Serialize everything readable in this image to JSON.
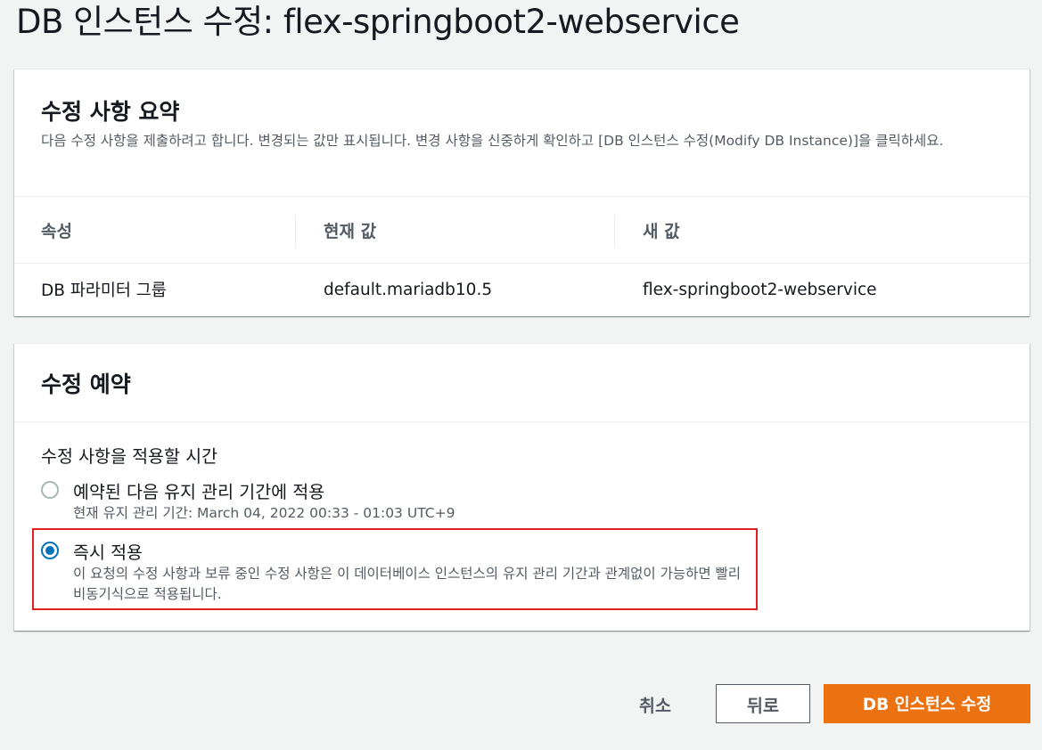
{
  "page": {
    "title": "DB 인스턴스 수정: flex-springboot2-webservice"
  },
  "summary": {
    "heading": "수정 사항 요약",
    "description": "다음 수정 사항을 제출하려고 합니다. 변경되는 값만 표시됩니다. 변경 사항을 신중하게 확인하고 [DB 인스턴스 수정(Modify DB Instance)]을 클릭하세요.",
    "columns": [
      "속성",
      "현재 값",
      "새 값"
    ],
    "rows": [
      {
        "attribute": "DB 파라미터 그룹",
        "current": "default.mariadb10.5",
        "new": "flex-springboot2-webservice"
      }
    ]
  },
  "schedule": {
    "heading": "수정 예약",
    "field_label": "수정 사항을 적용할 시간",
    "options": [
      {
        "label": "예약된 다음 유지 관리 기간에 적용",
        "description": "현재 유지 관리 기간: March 04, 2022 00:33 - 01:03 UTC+9",
        "selected": false
      },
      {
        "label": "즉시 적용",
        "description": "이 요청의 수정 사항과 보류 중인 수정 사항은 이 데이터베이스 인스턴스의 유지 관리 기간과 관계없이 가능하면 빨리 비동기식으로 적용됩니다.",
        "selected": true
      }
    ],
    "highlight_color": "#e02020"
  },
  "actions": {
    "cancel_label": "취소",
    "back_label": "뒤로",
    "submit_label": "DB 인스턴스 수정",
    "submit_color": "#ec7211"
  }
}
